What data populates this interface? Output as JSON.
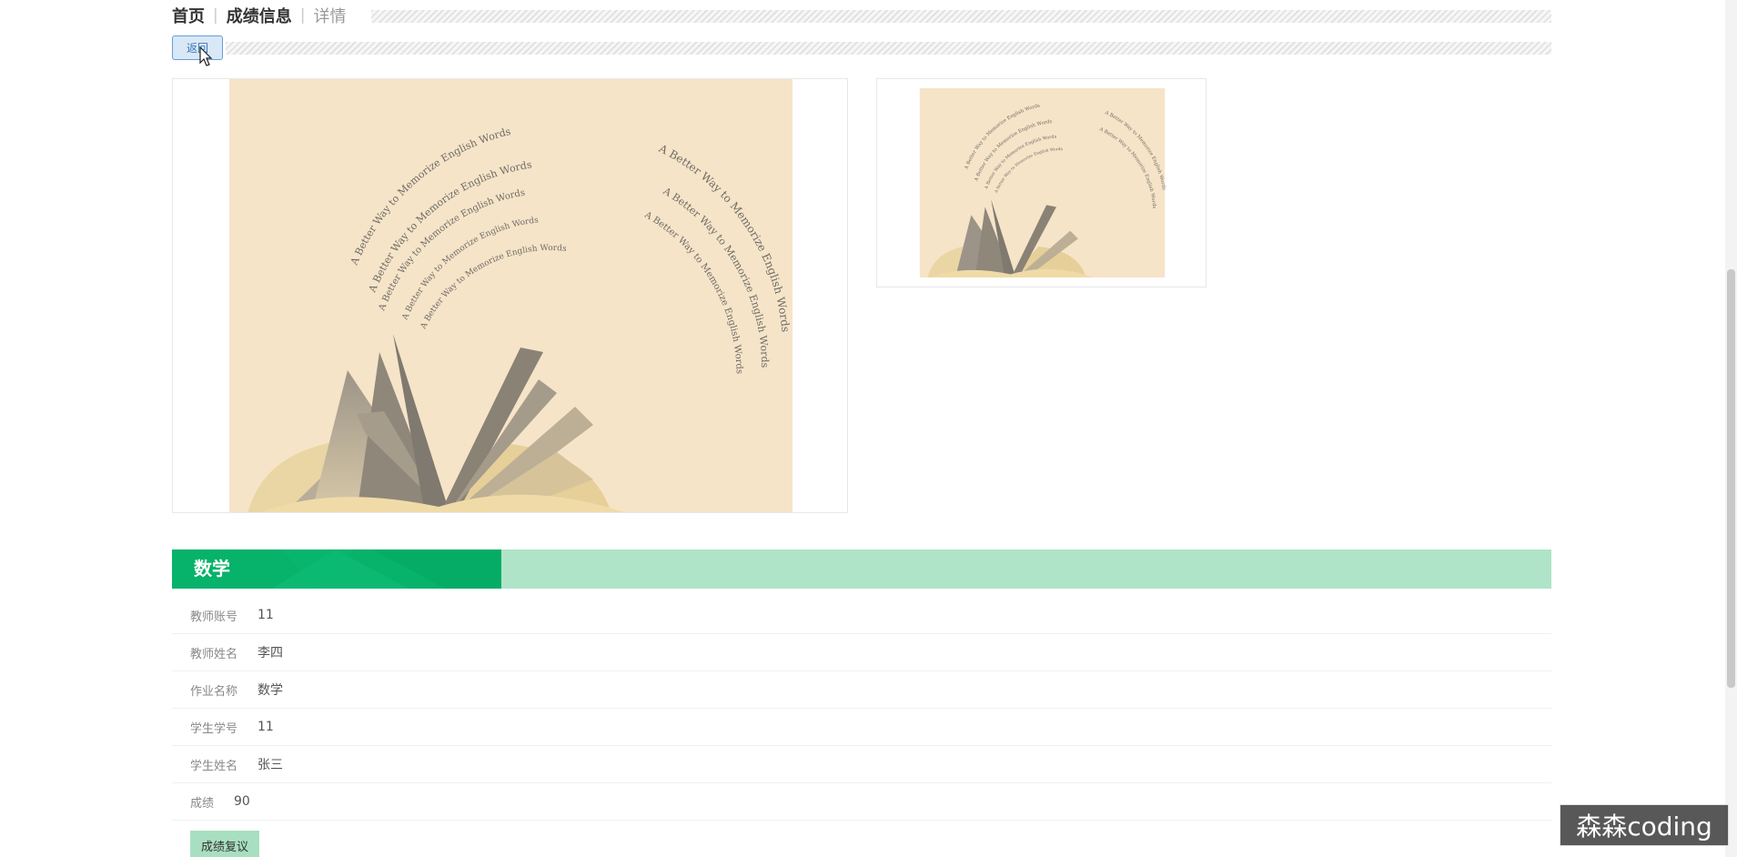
{
  "breadcrumb": {
    "home": "首页",
    "section": "成绩信息",
    "current": "详情"
  },
  "back_button": {
    "label": "返回"
  },
  "gallery": {
    "main_image_text": "A Better Way to Memorize English Words",
    "thumbnail_text": "A Better Way to Memorize English Words"
  },
  "section": {
    "title": "数学"
  },
  "details": {
    "teacher_account": {
      "label": "教师账号",
      "value": "11"
    },
    "teacher_name": {
      "label": "教师姓名",
      "value": "李四"
    },
    "assignment_name": {
      "label": "作业名称",
      "value": "数学"
    },
    "student_id": {
      "label": "学生学号",
      "value": "11"
    },
    "student_name": {
      "label": "学生姓名",
      "value": "张三"
    },
    "score": {
      "label": "成绩",
      "value": "90"
    }
  },
  "appeal_button": {
    "label": "成绩复议"
  },
  "watermark": {
    "text": "森森coding"
  },
  "colors": {
    "accent_green": "#07b26a",
    "header_light_green": "#b0e4c8",
    "back_button_blue": "#3977b6",
    "cover_bg": "#f6e4c8"
  },
  "icons": {
    "cursor": "mouse-pointer-icon",
    "cover_art": "open-book-icon"
  }
}
